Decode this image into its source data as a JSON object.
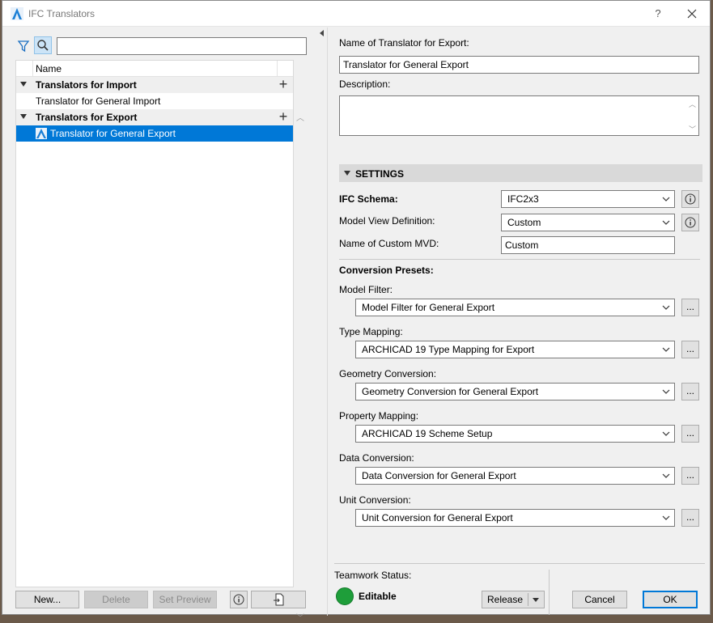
{
  "window": {
    "title": "IFC Translators",
    "help_label": "?"
  },
  "left": {
    "search": {
      "value": ""
    },
    "list_header": {
      "name": "Name"
    },
    "groups": [
      {
        "label": "Translators for Import",
        "items": [
          "Translator for General Import"
        ]
      },
      {
        "label": "Translators for Export",
        "items": [
          "Translator for General Export"
        ]
      }
    ],
    "selected_item": "Translator for General Export",
    "buttons": {
      "new": "New...",
      "delete": "Delete",
      "set_preview": "Set Preview"
    }
  },
  "right": {
    "name_label": "Name of Translator for Export:",
    "name_value": "Translator for General Export",
    "description_label": "Description:",
    "description_value": "",
    "settings_label": "SETTINGS",
    "ifc_schema": {
      "label": "IFC Schema:",
      "value": "IFC2x3"
    },
    "mvd": {
      "label": "Model View Definition:",
      "value": "Custom"
    },
    "custom_mvd": {
      "label": "Name of Custom MVD:",
      "value": "Custom"
    },
    "conversion_presets_label": "Conversion Presets:",
    "presets": [
      {
        "label": "Model Filter:",
        "value": "Model Filter for General Export"
      },
      {
        "label": "Type Mapping:",
        "value": "ARCHICAD 19 Type Mapping for Export"
      },
      {
        "label": "Geometry Conversion:",
        "value": "Geometry Conversion for General Export"
      },
      {
        "label": "Property Mapping:",
        "value": "ARCHICAD 19 Scheme Setup"
      },
      {
        "label": "Data Conversion:",
        "value": "Data Conversion for General Export"
      },
      {
        "label": "Unit Conversion:",
        "value": "Unit Conversion for General Export"
      }
    ],
    "dots_label": "...",
    "teamwork_label": "Teamwork Status:",
    "teamwork_status": "Editable",
    "release_label": "Release",
    "cancel_label": "Cancel",
    "ok_label": "OK"
  },
  "colors": {
    "selection": "#0078d7",
    "status_green": "#1e9e3a"
  }
}
